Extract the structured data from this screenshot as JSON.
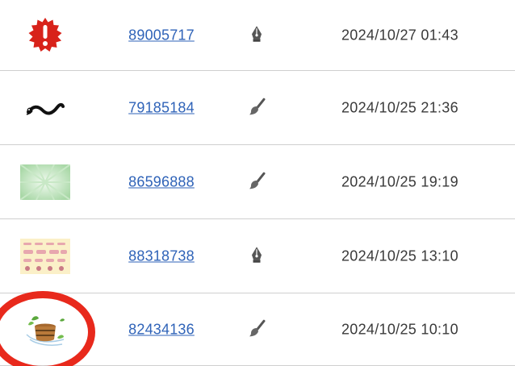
{
  "rows": [
    {
      "id": "89005717",
      "tool": "pen-nib-icon",
      "date": "2024/10/27 01:43",
      "thumbnail": "red-exclamation-badge-icon"
    },
    {
      "id": "79185184",
      "tool": "brush-icon",
      "date": "2024/10/25 21:36",
      "thumbnail": "black-eel-icon"
    },
    {
      "id": "86596888",
      "tool": "brush-icon",
      "date": "2024/10/25 19:19",
      "thumbnail": "green-sunburst-thumbnail"
    },
    {
      "id": "88318738",
      "tool": "pen-nib-icon",
      "date": "2024/10/25 13:10",
      "thumbnail": "pink-ribbon-grid-thumbnail"
    },
    {
      "id": "82434136",
      "tool": "brush-icon",
      "date": "2024/10/25 10:10",
      "thumbnail": "wooden-bucket-leaves-icon"
    }
  ],
  "colors": {
    "link": "#2f63b8",
    "annotation": "#e8291c",
    "divider": "#cfcfcf"
  }
}
